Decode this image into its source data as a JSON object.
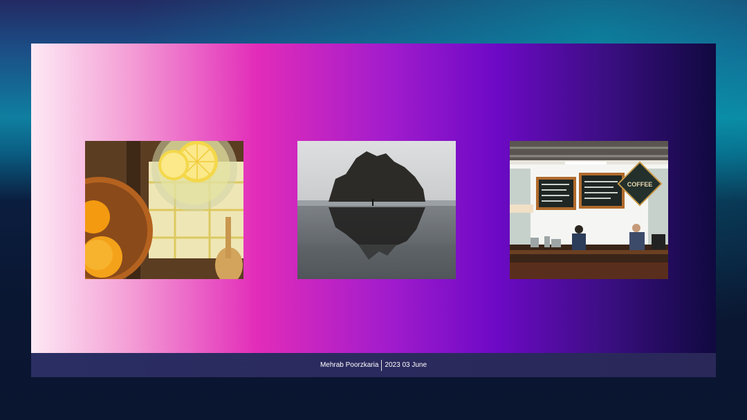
{
  "slide": {
    "photos": [
      {
        "subject": "lemon water and lemons in a bowl"
      },
      {
        "subject": "sea rock reflected on beach"
      },
      {
        "subject": "coffee shop counter with menu boards"
      }
    ],
    "cafe_sign_text": "COFFEE"
  },
  "footer": {
    "author": "Mehrab Poorzkaria",
    "date": "2023 03 June"
  }
}
